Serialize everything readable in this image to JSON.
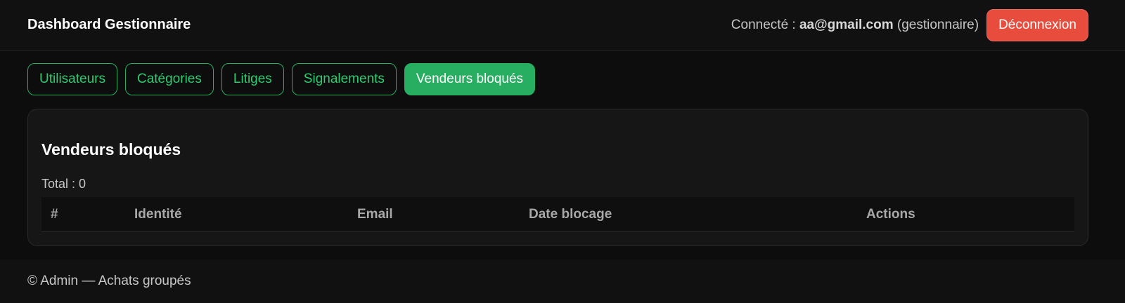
{
  "header": {
    "title": "Dashboard Gestionnaire",
    "connected_prefix": "Connecté :",
    "user_email": "aa@gmail.com",
    "user_role": "(gestionnaire)",
    "logout_label": "Déconnexion"
  },
  "tabs": [
    {
      "label": "Utilisateurs",
      "active": false
    },
    {
      "label": "Catégories",
      "active": false
    },
    {
      "label": "Litiges",
      "active": false
    },
    {
      "label": "Signalements",
      "active": false
    },
    {
      "label": "Vendeurs bloqués",
      "active": true
    }
  ],
  "main": {
    "title": "Vendeurs bloqués",
    "total_label": "Total : 0",
    "table": {
      "columns": [
        "#",
        "Identité",
        "Email",
        "Date blocage",
        "Actions"
      ],
      "rows": []
    }
  },
  "footer": {
    "text": "© Admin — Achats groupés"
  },
  "colors": {
    "accent": "#27ae60",
    "danger": "#e74c3c",
    "background": "#0d0d0d"
  }
}
